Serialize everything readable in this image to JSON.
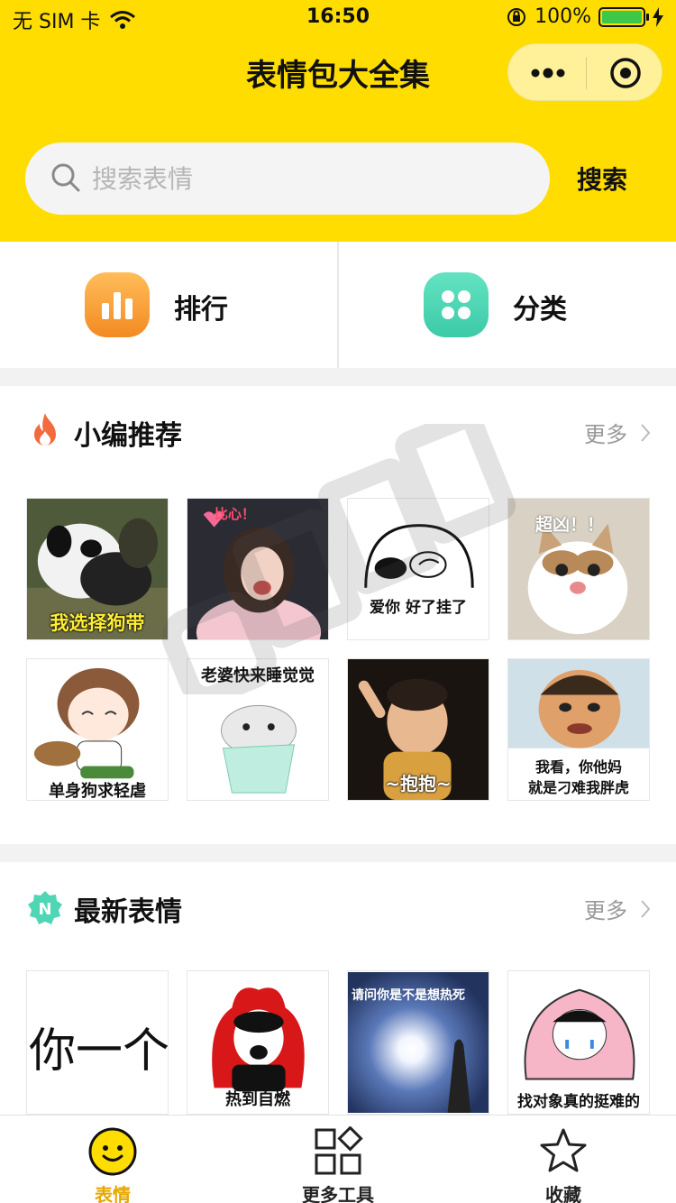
{
  "status_bar": {
    "carrier": "无 SIM 卡",
    "time": "16:50",
    "battery": "100%"
  },
  "nav": {
    "title": "表情包大全集"
  },
  "search": {
    "placeholder": "搜索表情",
    "button": "搜索"
  },
  "quick": [
    {
      "label": "排行",
      "icon": "bar-chart-icon",
      "color": "#f7a13a"
    },
    {
      "label": "分类",
      "icon": "grid-dots-icon",
      "color": "#4fd6b4"
    }
  ],
  "recommend": {
    "title": "小编推荐",
    "more": "更多",
    "items": [
      {
        "caption": "我选择狗带"
      },
      {
        "caption": "比心！"
      },
      {
        "caption": "爱你  好了挂了"
      },
      {
        "caption": "超凶！！"
      },
      {
        "caption": "单身狗求轻虐"
      },
      {
        "caption": "老婆快来睡觉觉"
      },
      {
        "caption": "~抱抱~"
      },
      {
        "caption": "我看，你他妈\n就是刁难我胖虎"
      }
    ]
  },
  "latest": {
    "title": "最新表情",
    "more": "更多",
    "badge": "N",
    "items": [
      {
        "caption": "你一个"
      },
      {
        "caption": "热到自燃"
      },
      {
        "caption": "请问你是不是想热死"
      },
      {
        "caption": "找对象真的挺难的"
      }
    ]
  },
  "tabbar": [
    {
      "label": "表情",
      "icon": "smiley-icon"
    },
    {
      "label": "更多工具",
      "icon": "tools-icon"
    },
    {
      "label": "收藏",
      "icon": "star-icon"
    }
  ],
  "colors": {
    "brand_yellow": "#ffdd00",
    "accent_orange": "#f7a13a",
    "accent_green": "#4fd6b4"
  }
}
